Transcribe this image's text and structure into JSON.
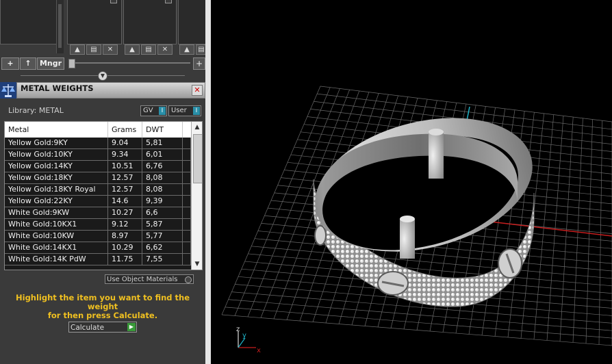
{
  "toolbar": {
    "add_label": "+",
    "up_label": "↑",
    "mngr_label": "Mngr",
    "right_add_label": "+"
  },
  "metal_weights": {
    "title": "METAL WEIGHTS",
    "library_label": "Library: METAL",
    "toggle_gv": "GV",
    "toggle_user": "User",
    "columns": [
      "Metal",
      "Grams",
      "DWT"
    ],
    "rows": [
      [
        "Yellow Gold:9KY",
        "9.04",
        "5,81"
      ],
      [
        "Yellow Gold:10KY",
        "9.34",
        "6,01"
      ],
      [
        "Yellow Gold:14KY",
        "10.51",
        "6,76"
      ],
      [
        "Yellow Gold:18KY",
        "12.57",
        "8,08"
      ],
      [
        "Yellow Gold:18KY Royal",
        "12.57",
        "8,08"
      ],
      [
        "Yellow Gold:22KY",
        "14.6",
        "9,39"
      ],
      [
        "White Gold:9KW",
        "10.27",
        "6,6"
      ],
      [
        "White Gold:10KX1",
        "9.12",
        "5,87"
      ],
      [
        "White Gold:10KW",
        "8.97",
        "5,77"
      ],
      [
        "White Gold:14KX1",
        "10.29",
        "6,62"
      ],
      [
        "White Gold:14K PdW",
        "11.75",
        "7,55"
      ]
    ],
    "use_object_materials": "Use Object Materials",
    "hint_line1": "Highlight the item you want to find the weight",
    "hint_line2": "for then press Calculate.",
    "calculate_label": "Calculate"
  },
  "axis_gizmo": {
    "x_label": "x",
    "y_label": "y",
    "z_label": "z"
  },
  "colors": {
    "accent_teal": "#2a8fa8",
    "hint_yellow": "#f0c020",
    "axis_red": "#c81e1e",
    "axis_cyan": "#1eb4c8"
  }
}
